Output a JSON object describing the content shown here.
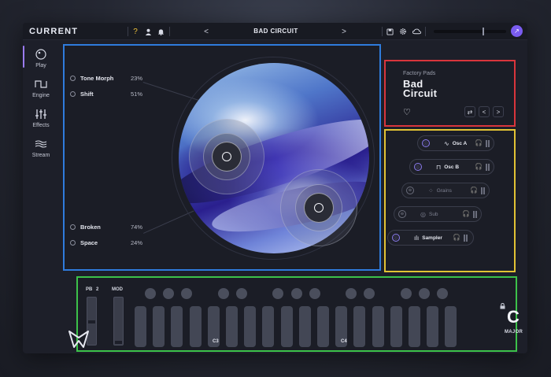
{
  "app": {
    "logo": "CURRENT",
    "preset_title": "BAD CIRCUIT",
    "prev": "<",
    "next": ">",
    "help": "?",
    "user_initial": "↗"
  },
  "sidebar": {
    "items": [
      {
        "label": "Play",
        "icon": "play-dial-icon"
      },
      {
        "label": "Engine",
        "icon": "square-wave-icon"
      },
      {
        "label": "Effects",
        "icon": "sliders-icon"
      },
      {
        "label": "Stream",
        "icon": "stream-waves-icon"
      }
    ]
  },
  "main": {
    "params": [
      {
        "name": "Tone Morph",
        "value": "23%"
      },
      {
        "name": "Shift",
        "value": "51%"
      },
      {
        "name": "Broken",
        "value": "74%"
      },
      {
        "name": "Space",
        "value": "24%"
      }
    ]
  },
  "preset": {
    "bank": "Factory Pads",
    "name_line1": "Bad",
    "name_line2": "Circuit",
    "heart": "♡",
    "shuffle": "⇄",
    "prev": "<",
    "next": ">"
  },
  "oscillators": [
    {
      "name": "Osc A",
      "enabled": true,
      "wave": "∿"
    },
    {
      "name": "Osc B",
      "enabled": true,
      "wave": "⊓"
    },
    {
      "name": "Grains",
      "enabled": false,
      "wave": "⁘"
    },
    {
      "name": "Sub",
      "enabled": false,
      "wave": "◎"
    },
    {
      "name": "Sampler",
      "enabled": true,
      "wave": "ılı"
    }
  ],
  "keyboard": {
    "pb_label": "PB",
    "pb_range": "2",
    "mod_label": "MOD",
    "key_labels": [
      "C3",
      "C4"
    ],
    "scale_root": "C",
    "scale_mode": "MAJOR",
    "lock_icon": "🔒"
  },
  "colors": {
    "accent": "#9b7cf6",
    "main_outline": "#2f7bdc",
    "preset_outline": "#d9353c",
    "osc_outline": "#e2c234",
    "keyboard_outline": "#3cc24a"
  }
}
